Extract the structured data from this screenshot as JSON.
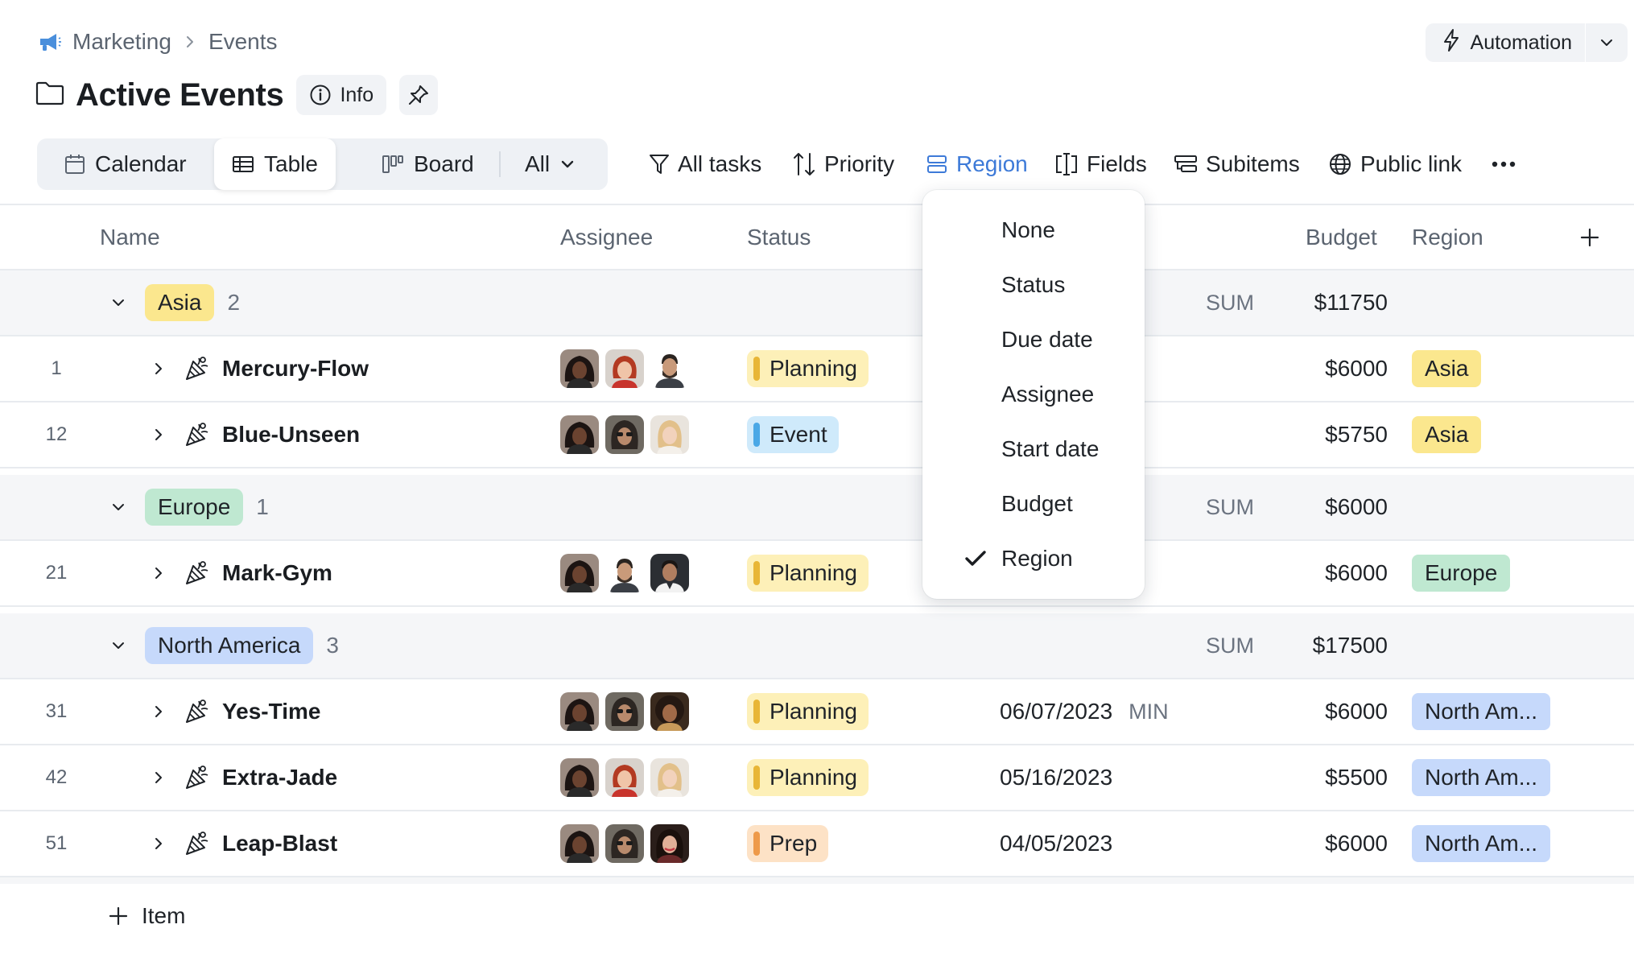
{
  "breadcrumb": {
    "items": [
      "Marketing",
      "Events"
    ]
  },
  "automation": {
    "label": "Automation"
  },
  "title": {
    "text": "Active Events",
    "info_label": "Info"
  },
  "views": {
    "calendar": "Calendar",
    "table": "Table",
    "board": "Board",
    "filter": "All"
  },
  "toolbar": {
    "all_tasks": "All tasks",
    "priority": "Priority",
    "region": "Region",
    "fields": "Fields",
    "subitems": "Subitems",
    "public_link": "Public link"
  },
  "table": {
    "columns": {
      "name": "Name",
      "assignee": "Assignee",
      "status": "Status",
      "budget": "Budget",
      "region": "Region"
    },
    "sum_label": "SUM",
    "min_label": "MIN",
    "add_item_label": "Item",
    "groups": [
      {
        "name": "Asia",
        "count": "2",
        "sum": "$11750",
        "color": "#fbe78e",
        "items": [
          {
            "id": "1",
            "name": "Mercury-Flow",
            "status": "Planning",
            "date": "",
            "budget": "$6000",
            "region": "Asia",
            "avatars": [
              "a1",
              "a4",
              "a3"
            ]
          },
          {
            "id": "12",
            "name": "Blue-Unseen",
            "status": "Event",
            "date": "",
            "budget": "$5750",
            "region": "Asia",
            "avatars": [
              "a1",
              "a2",
              "a6"
            ]
          }
        ]
      },
      {
        "name": "Europe",
        "count": "1",
        "sum": "$6000",
        "color": "#bfe8d1",
        "items": [
          {
            "id": "21",
            "name": "Mark-Gym",
            "status": "Planning",
            "date": "",
            "budget": "$6000",
            "region": "Europe",
            "avatars": [
              "a1",
              "a3",
              "a5"
            ]
          }
        ]
      },
      {
        "name": "North America",
        "count": "3",
        "sum": "$17500",
        "color": "#c6d9fb",
        "items": [
          {
            "id": "31",
            "name": "Yes-Time",
            "status": "Planning",
            "date": "06/07/2023",
            "budget": "$6000",
            "region": "North Am...",
            "avatars": [
              "a1",
              "a2",
              "a7"
            ]
          },
          {
            "id": "42",
            "name": "Extra-Jade",
            "status": "Planning",
            "date": "05/16/2023",
            "budget": "$5500",
            "region": "North Am...",
            "avatars": [
              "a1",
              "a4",
              "a6"
            ]
          },
          {
            "id": "51",
            "name": "Leap-Blast",
            "status": "Prep",
            "date": "04/05/2023",
            "budget": "$6000",
            "region": "North Am...",
            "avatars": [
              "a1",
              "a2",
              "a8"
            ]
          }
        ]
      }
    ]
  },
  "status_colors": {
    "Planning": {
      "bg": "#fdf0b8",
      "bar": "#e8b636"
    },
    "Event": {
      "bg": "#cfeafb",
      "bar": "#4aa8e6"
    },
    "Prep": {
      "bg": "#fde2c6",
      "bar": "#ee9a4a"
    }
  },
  "group_by_menu": {
    "options": [
      "None",
      "Status",
      "Due date",
      "Assignee",
      "Start date",
      "Budget",
      "Region"
    ],
    "selected": "Region"
  },
  "accent_color": "#3d7ad8"
}
